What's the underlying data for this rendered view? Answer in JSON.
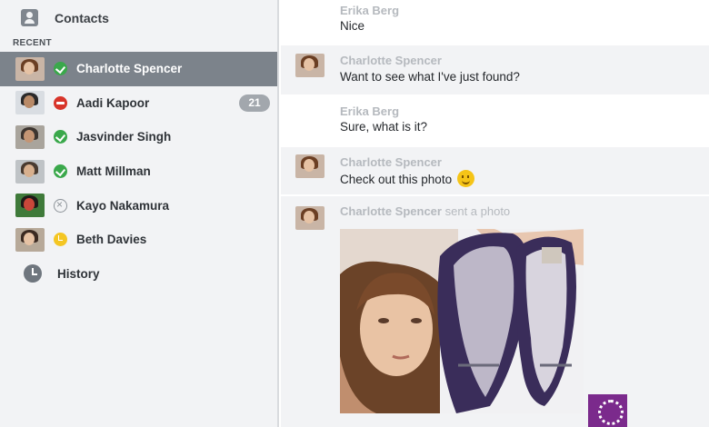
{
  "sidebar": {
    "contacts_label": "Contacts",
    "recent_label": "RECENT",
    "contacts": [
      {
        "name": "Charlotte Spencer",
        "status": "online",
        "selected": true
      },
      {
        "name": "Aadi Kapoor",
        "status": "busy",
        "badge": "21"
      },
      {
        "name": "Jasvinder Singh",
        "status": "online"
      },
      {
        "name": "Matt Millman",
        "status": "online"
      },
      {
        "name": "Kayo Nakamura",
        "status": "offline"
      },
      {
        "name": "Beth Davies",
        "status": "away"
      }
    ],
    "history_label": "History"
  },
  "conversation": {
    "messages": [
      {
        "sender": "Erika Berg",
        "text": "Nice"
      },
      {
        "sender": "Charlotte Spencer",
        "text": "Want to see what I've just found?"
      },
      {
        "sender": "Erika Berg",
        "text": "Sure, what is it?"
      },
      {
        "sender": "Charlotte Spencer",
        "text": "Check out this photo"
      },
      {
        "sender": "Charlotte Spencer",
        "note": "sent a photo"
      }
    ]
  },
  "colors": {
    "online": "#3aa84b",
    "busy": "#d8342a",
    "away": "#f4c623",
    "selected_row": "#7c838b",
    "sidebar_bg": "#f2f3f5"
  }
}
